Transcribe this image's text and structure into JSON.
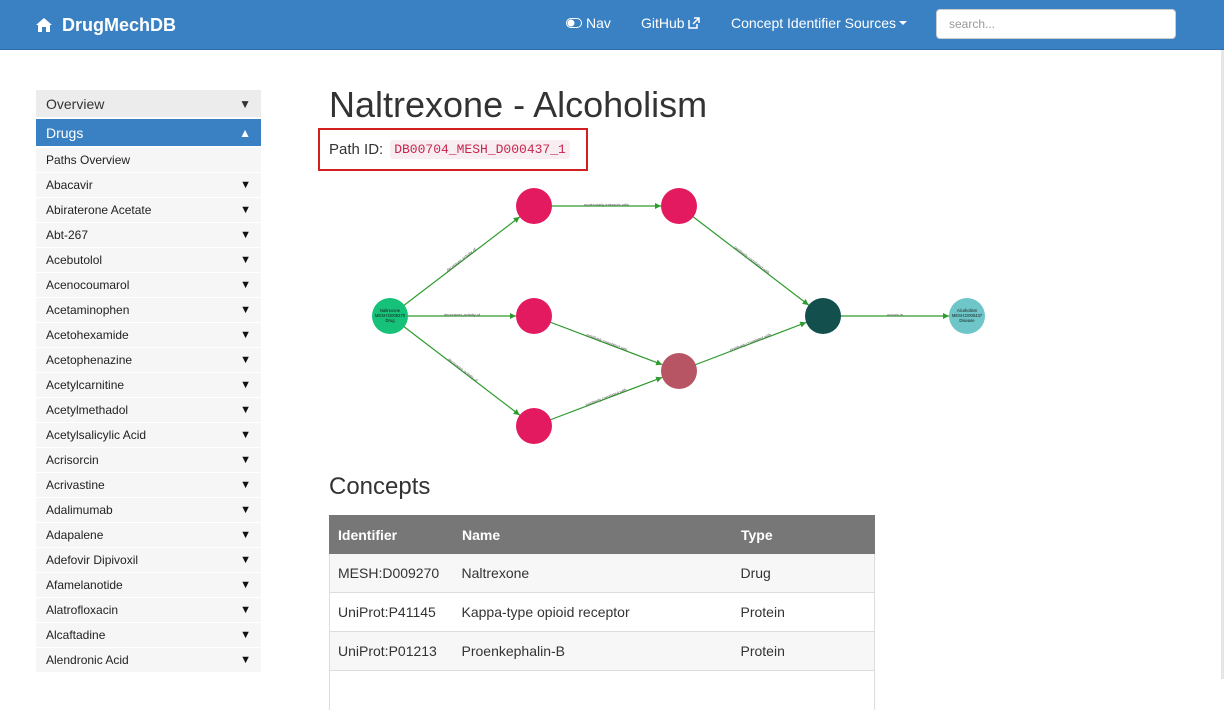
{
  "navbar": {
    "brand": "DrugMechDB",
    "nav_toggle": "Nav",
    "github": "GitHub",
    "sources": "Concept Identifier Sources",
    "search_placeholder": "search..."
  },
  "sidebar": {
    "overview": "Overview",
    "drugs": "Drugs",
    "items": [
      "Paths Overview",
      "Abacavir",
      "Abiraterone Acetate",
      "Abt-267",
      "Acebutolol",
      "Acenocoumarol",
      "Acetaminophen",
      "Acetohexamide",
      "Acetophenazine",
      "Acetylcarnitine",
      "Acetylmethadol",
      "Acetylsalicylic Acid",
      "Acrisorcin",
      "Acrivastine",
      "Adalimumab",
      "Adapalene",
      "Adefovir Dipivoxil",
      "Afamelanotide",
      "Alatrofloxacin",
      "Alcaftadine",
      "Alendronic Acid"
    ]
  },
  "page": {
    "title": "Naltrexone - Alcoholism",
    "path_label": "Path ID:",
    "path_id": "DB00704_MESH_D000437_1"
  },
  "graph": {
    "nodes": [
      {
        "id": "drug",
        "label": [
          "Naltrexone",
          "MESH:D009270",
          "Drug"
        ],
        "color": "#16c27a"
      },
      {
        "id": "p1",
        "label": [
          "",
          "",
          ""
        ],
        "color": "#e31a5f"
      },
      {
        "id": "p2",
        "label": [
          "",
          "",
          ""
        ],
        "color": "#e31a5f"
      },
      {
        "id": "p3",
        "label": [
          "",
          "",
          ""
        ],
        "color": "#e31a5f"
      },
      {
        "id": "p4",
        "label": [
          "",
          "",
          ""
        ],
        "color": "#e31a5f"
      },
      {
        "id": "bp",
        "label": [
          "",
          "",
          ""
        ],
        "color": "#b85565"
      },
      {
        "id": "pheno",
        "label": [
          "",
          "",
          ""
        ],
        "color": "#134f4d"
      },
      {
        "id": "disease",
        "label": [
          "Alcoholism",
          "MESH:D000437",
          "Disease"
        ],
        "color": "#6ec6c8"
      }
    ],
    "edges": [
      {
        "from": "drug",
        "to": "p1",
        "label": "decreases activity of"
      },
      {
        "from": "drug",
        "to": "p3",
        "label": "decreases activity of"
      },
      {
        "from": "drug",
        "to": "p4",
        "label": "decreases activity of"
      },
      {
        "from": "p1",
        "to": "p2",
        "label": "molecularly interacts with"
      },
      {
        "from": "p2",
        "to": "pheno",
        "label": "positively correlated with"
      },
      {
        "from": "p3",
        "to": "bp",
        "label": "positively correlated with"
      },
      {
        "from": "p4",
        "to": "bp",
        "label": "positively correlated with"
      },
      {
        "from": "bp",
        "to": "pheno",
        "label": "positively correlated with"
      },
      {
        "from": "pheno",
        "to": "disease",
        "label": "occurs in"
      }
    ]
  },
  "concepts": {
    "heading": "Concepts",
    "columns": [
      "Identifier",
      "Name",
      "Type"
    ],
    "rows": [
      [
        "MESH:D009270",
        "Naltrexone",
        "Drug"
      ],
      [
        "UniProt:P41145",
        "Kappa-type opioid receptor",
        "Protein"
      ],
      [
        "UniProt:P01213",
        "Proenkephalin-B",
        "Protein"
      ]
    ]
  }
}
